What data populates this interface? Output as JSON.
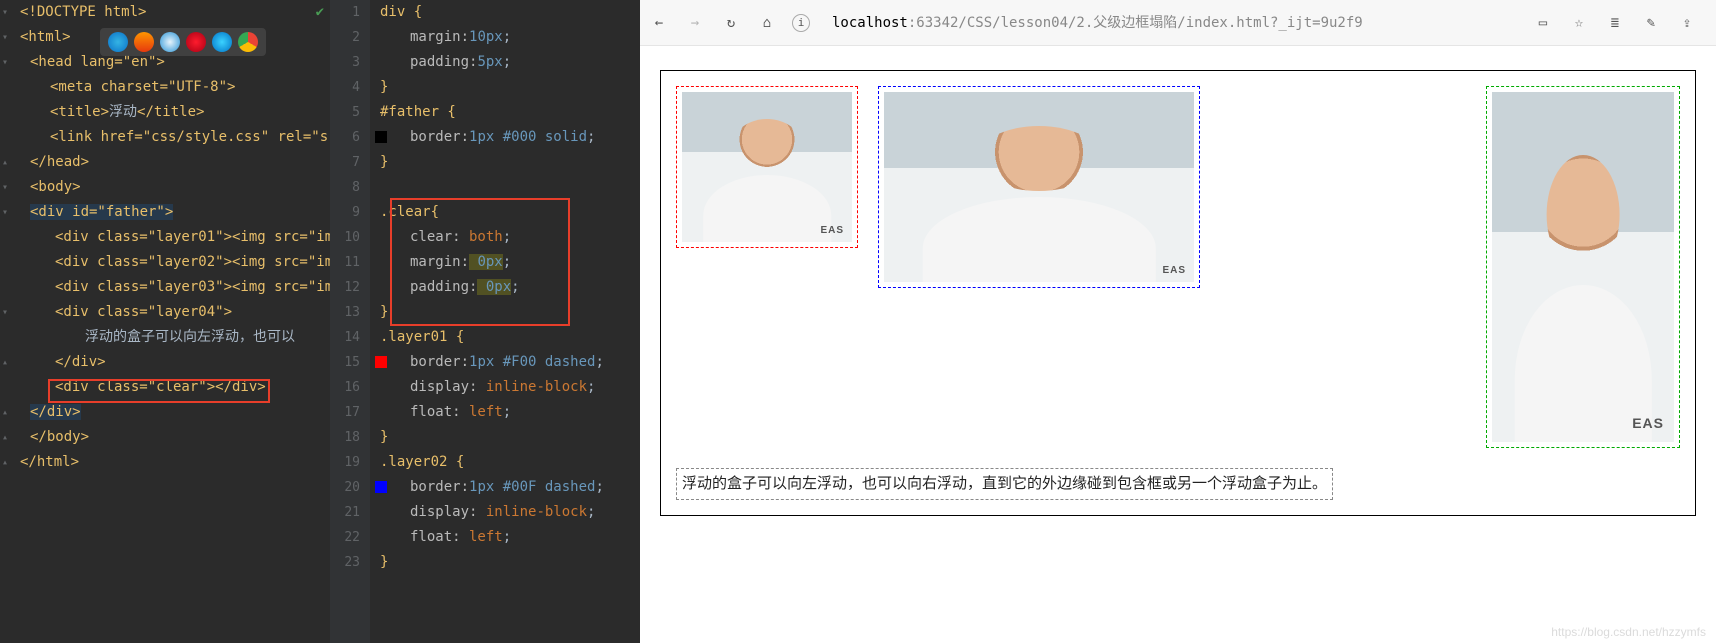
{
  "left_code": {
    "l1": "<!DOCTYPE html>",
    "l2": "<html>",
    "l3": "<head lang=\"en\">",
    "l4": "<meta charset=\"UTF-8\">",
    "l5_open": "<title>",
    "l5_txt": "浮动",
    "l5_close": "</title>",
    "l6": "<link href=\"css/style.css\" rel=\"s",
    "l7": "</head>",
    "l8": "<body>",
    "l9": "<div id=\"father\">",
    "l10": "<div class=\"layer01\"><img src=\"im",
    "l11": "<div class=\"layer02\"><img src=\"im",
    "l12": "<div class=\"layer03\"><img src=\"im",
    "l13": "<div class=\"layer04\">",
    "l14": "浮动的盒子可以向左浮动，也可以",
    "l15": "</div>",
    "l16": "<div class=\"clear\"></div>",
    "l17": "</div>",
    "l18": "</body>",
    "l19": "</html>"
  },
  "mid_code": {
    "ln": [
      "1",
      "2",
      "3",
      "4",
      "5",
      "6",
      "7",
      "8",
      "9",
      "10",
      "11",
      "12",
      "13",
      "14",
      "15",
      "16",
      "17",
      "18",
      "19",
      "20",
      "21",
      "22",
      "23"
    ],
    "c1": "div {",
    "c2_p": "margin:",
    "c2_v": "10px",
    "c2_s": ";",
    "c3_p": "padding:",
    "c3_v": "5px",
    "c3_s": ";",
    "c4": "}",
    "c5": "#father {",
    "c6_p": "border:",
    "c6_v": "1px #000 solid",
    "c6_s": ";",
    "c7": "}",
    "c8": "",
    "c9": ".clear{",
    "c10_p": "clear:",
    "c10_v": " both",
    "c10_s": ";",
    "c11_p": "margin:",
    "c11_v": " 0px",
    "c11_s": ";",
    "c12_p": "padding:",
    "c12_v": " 0px",
    "c12_s": ";",
    "c13": "}",
    "c14": ".layer01 {",
    "c15_p": "border:",
    "c15_v": "1px #F00 dashed",
    "c15_s": ";",
    "c16_p": "display:",
    "c16_v": " inline-block",
    "c16_s": ";",
    "c17_p": "float:",
    "c17_v": " left",
    "c17_s": ";",
    "c18": "}",
    "c19": ".layer02 {",
    "c20_p": "border:",
    "c20_v": "1px #00F dashed",
    "c20_s": ";",
    "c21_p": "display:",
    "c21_v": " inline-block",
    "c21_s": ";",
    "c22_p": "float:",
    "c22_v": " left",
    "c22_s": ";",
    "c23": "}"
  },
  "browser": {
    "url_host": "localhost",
    "url_path": ":63342/CSS/lesson04/2.父级边框塌陷/index.html?_ijt=9u2f9",
    "layer04_text": "浮动的盒子可以向左浮动，也可以向右浮动，直到它的外边缘碰到包含框或另一个浮动盒子为止。",
    "eas": "EAS",
    "watermark": "https://blog.csdn.net/hzzymfs"
  }
}
